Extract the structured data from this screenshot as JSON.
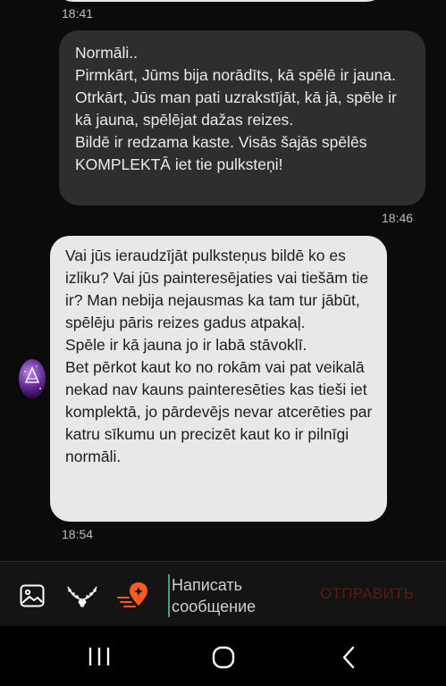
{
  "messages": [
    {
      "direction": "outgoing",
      "time": "18:46",
      "text": "Normāli..\nPirmkārt,  Jūms bija norādīts, kā spēlē ir jauna. Otrkārt, Jūs man pati uzrakstījāt, kā jā, spēle ir kā jauna, spēlējat dažas reizes.\nBildē ir redzama kaste. Visās šajās spēlēs KOMPLEKTĀ iet tie pulksteņi!"
    },
    {
      "direction": "incoming",
      "time": "18:54",
      "text": "Vai jūs ieraudzījāt pulksteņus bildē ko es izliku? Vai jūs painteresējaties vai tiešām tie ir? Man nebija nejausmas ka tam tur jābūt, spēlēju pāris reizes gadus atpakaļ.\nSpēle ir kā jauna jo ir labā stāvoklī.\nBet pērkot kaut ko no rokām vai pat veikalā nekad nav kauns painteresēties kas tieši iet komplektā, jo pārdevējs  nevar atcerēties par katru sīkumu un precizēt kaut ko ir pilnīgi normāli."
    }
  ],
  "previous_time": "18:41",
  "composer": {
    "placeholder": "Написать\nсообщение",
    "send_label": "ОТПРАВИТЬ",
    "icons": [
      "gallery-icon",
      "sticker-icon",
      "location-icon"
    ]
  },
  "colors": {
    "outgoing_bubble": "#2e2e2e",
    "incoming_bubble": "#e8e8e8",
    "send_disabled": "#5a1b14",
    "accent_orange": "#ff5a1f",
    "cursor": "#3aa38a"
  },
  "navigation": [
    "recents-icon",
    "home-icon",
    "back-icon"
  ]
}
